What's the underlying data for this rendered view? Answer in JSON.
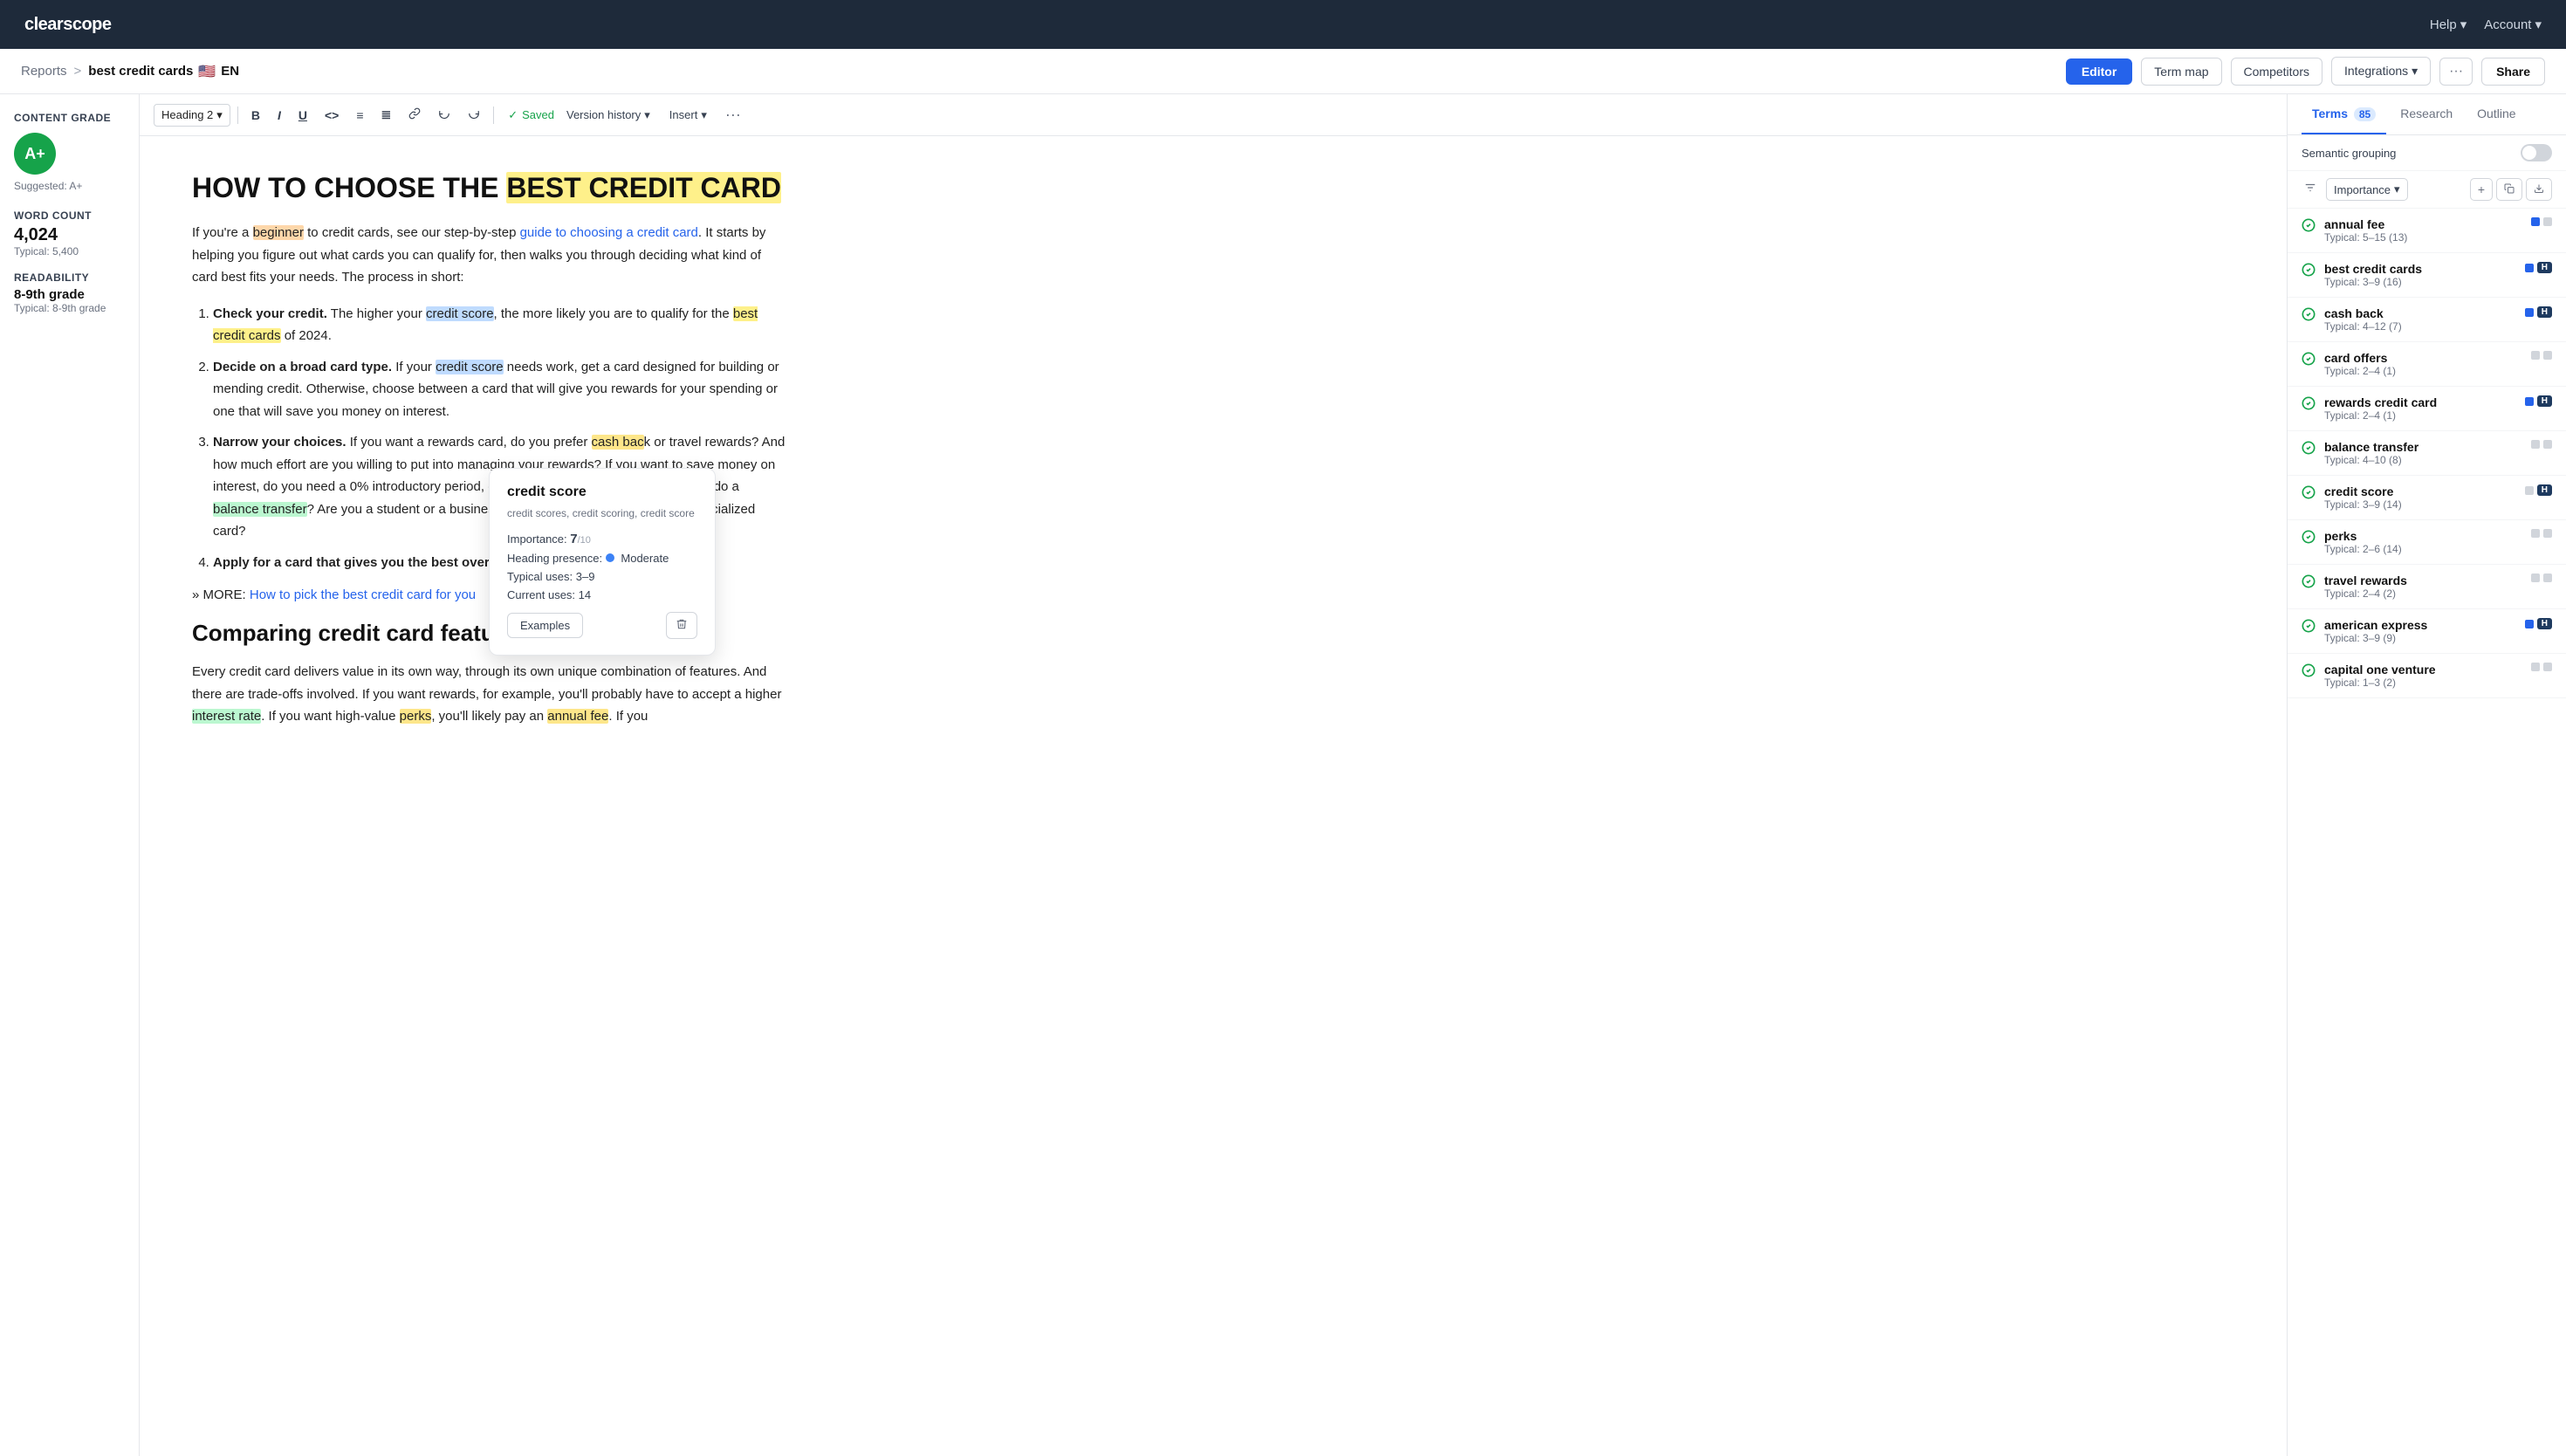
{
  "app": {
    "name": "clearscope"
  },
  "topnav": {
    "logo": "clearscope",
    "help_label": "Help",
    "account_label": "Account"
  },
  "breadcrumb": {
    "reports_label": "Reports",
    "separator": ">",
    "current_doc": "best credit cards",
    "flag": "🇺🇸",
    "lang": "EN"
  },
  "toolbar_right": {
    "editor_label": "Editor",
    "term_map_label": "Term map",
    "competitors_label": "Competitors",
    "integrations_label": "Integrations",
    "more_label": "···",
    "share_label": "Share"
  },
  "editor_toolbar": {
    "heading_select": "Heading 2",
    "bold": "B",
    "italic": "I",
    "underline": "U",
    "code": "<>",
    "bullet_list": "≡",
    "ordered_list": "≣",
    "link": "🔗",
    "undo": "↩",
    "redo": "↪",
    "saved_label": "Saved",
    "version_history_label": "Version history",
    "insert_label": "Insert",
    "more_label": "···"
  },
  "left_sidebar": {
    "content_grade_label": "Content grade",
    "grade": "A+",
    "suggested_label": "Suggested: A+",
    "word_count_label": "Word count",
    "word_count": "4,024",
    "word_count_typical": "Typical: 5,400",
    "readability_label": "Readability",
    "readability_value": "8-9th grade",
    "readability_typical": "Typical: 8-9th grade"
  },
  "document": {
    "h1": "HOW TO CHOOSE THE BEST CREDIT CARD",
    "h1_highlight": "BEST CREDIT CARD",
    "p1": "If you're a beginner to credit cards, see our step-by-step guide to choosing a credit card. It starts by helping you figure out what cards you can qualify for, then walks you through deciding what kind of card best fits your needs. The process in short:",
    "p1_link": "guide to choosing a credit card",
    "list_items": [
      {
        "bold": "Check your credit.",
        "text": " The higher your credit score, the more likely you are to qualify for the best credit cards of 2024."
      },
      {
        "bold": "Decide on a broad card type.",
        "text": " If your credit score needs work, get a card designed for building or mending credit. Otherwise, choose between a card that will give you rewards for your spending or one that will save you money on interest."
      },
      {
        "bold": "Narrow your choices.",
        "text": " If you want a rewards card, do you prefer cash back or travel rewards? And how much effort are you willing to put into managing your rewards? If you want to save money on interest, do you need a 0% introductory period, or a low ongoing rate? Do you need to do a balance transfer? Are you a student or a business owner who could benefit from a specialized card?"
      },
      {
        "bold": "Apply for a card that gives you the best overall value.",
        "text": ""
      }
    ],
    "more_line": "» MORE: How to pick the best credit card for you",
    "more_link": "How to pick the best credit card for you",
    "h2": "Comparing credit card features",
    "p2": "Every credit card delivers value in its own way, through its own unique combination of features. And there are trade-offs involved. If you want rewards, for example, you'll probably have to accept a higher interest rate. If you want high-value perks, you'll likely pay an annual fee. If you"
  },
  "term_popup": {
    "title": "credit score",
    "variants": "credit scores, credit scoring, credit score",
    "importance_label": "Importance:",
    "importance_value": "7",
    "importance_denom": "/10",
    "heading_presence_label": "Heading presence:",
    "heading_presence_value": "Moderate",
    "typical_uses_label": "Typical uses:",
    "typical_uses_value": "3–9",
    "current_uses_label": "Current uses:",
    "current_uses_value": "14",
    "examples_label": "Examples"
  },
  "right_sidebar": {
    "tab_terms": "Terms",
    "tab_terms_count": "85",
    "tab_research": "Research",
    "tab_outline": "Outline",
    "semantic_grouping_label": "Semantic grouping",
    "sort_label": "Importance",
    "terms": [
      {
        "name": "annual fee",
        "typical": "Typical: 5–15 (13)",
        "badge_blue": true,
        "badge_h": false
      },
      {
        "name": "best credit cards",
        "typical": "Typical: 3–9 (16)",
        "badge_blue": true,
        "badge_h": true
      },
      {
        "name": "cash back",
        "typical": "Typical: 4–12 (7)",
        "badge_blue": true,
        "badge_h": true
      },
      {
        "name": "card offers",
        "typical": "Typical: 2–4 (1)",
        "badge_blue": false,
        "badge_h": false
      },
      {
        "name": "rewards credit card",
        "typical": "Typical: 2–4 (1)",
        "badge_blue": true,
        "badge_h": true
      },
      {
        "name": "balance transfer",
        "typical": "Typical: 4–10 (8)",
        "badge_blue": false,
        "badge_h": false
      },
      {
        "name": "credit score",
        "typical": "Typical: 3–9 (14)",
        "badge_blue": false,
        "badge_h": true
      },
      {
        "name": "perks",
        "typical": "Typical: 2–6 (14)",
        "badge_blue": false,
        "badge_h": false
      },
      {
        "name": "travel rewards",
        "typical": "Typical: 2–4 (2)",
        "badge_blue": false,
        "badge_h": false
      },
      {
        "name": "american express",
        "typical": "Typical: 3–9 (9)",
        "badge_blue": true,
        "badge_h": true
      },
      {
        "name": "capital one venture",
        "typical": "Typical: 1–3 (2)",
        "badge_blue": false,
        "badge_h": false
      }
    ]
  }
}
